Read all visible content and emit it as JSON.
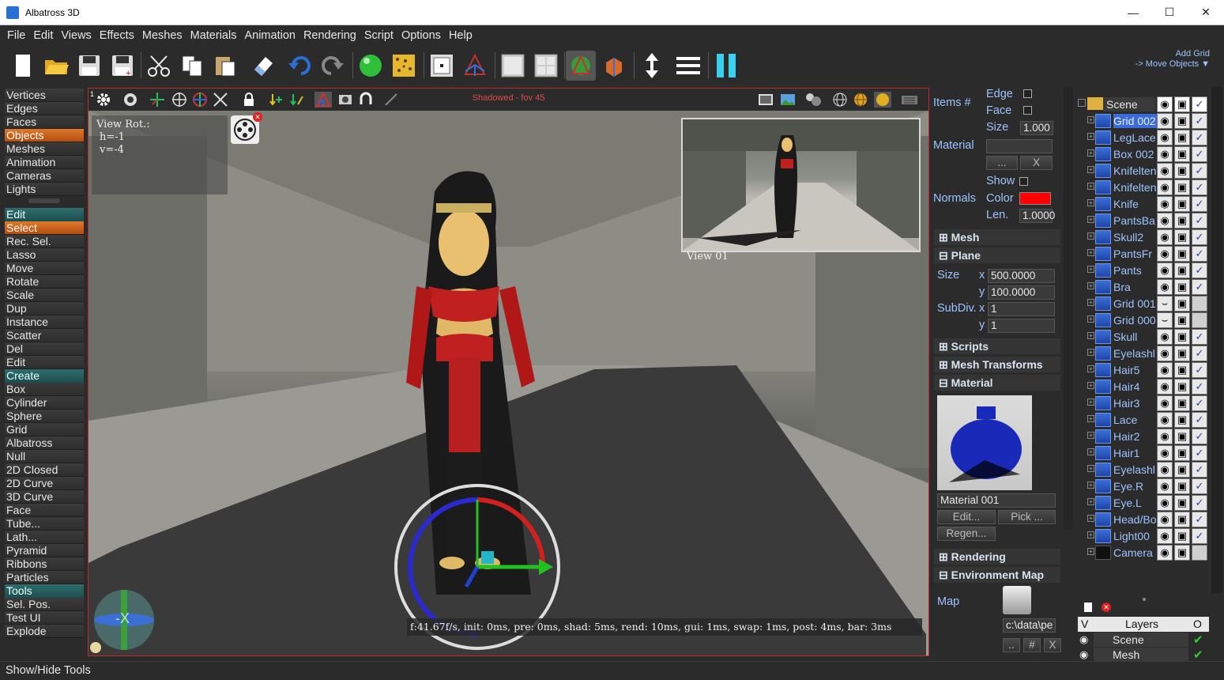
{
  "window": {
    "title": "Albatross 3D"
  },
  "menu": [
    "File",
    "Edit",
    "Views",
    "Effects",
    "Meshes",
    "Materials",
    "Animation",
    "Rendering",
    "Script",
    "Options",
    "Help"
  ],
  "toolbar_hint": {
    "line1": "Add Grid",
    "line2": "-> Move Objects"
  },
  "left_panel": {
    "modes": [
      {
        "label": "Vertices",
        "active": false
      },
      {
        "label": "Edges",
        "active": false
      },
      {
        "label": "Faces",
        "active": false
      },
      {
        "label": "Objects",
        "active": true
      },
      {
        "label": "Meshes",
        "active": false
      },
      {
        "label": "Animation",
        "active": false
      },
      {
        "label": "Cameras",
        "active": false
      },
      {
        "label": "Lights",
        "active": false
      }
    ],
    "edit_header": "Edit",
    "edit_items": [
      {
        "label": "Select",
        "active": true
      },
      {
        "label": "Rec. Sel.",
        "active": false
      },
      {
        "label": "Lasso",
        "active": false
      },
      {
        "label": "Move",
        "active": false
      },
      {
        "label": "Rotate",
        "active": false
      },
      {
        "label": "Scale",
        "active": false
      },
      {
        "label": "Dup",
        "active": false
      },
      {
        "label": "Instance",
        "active": false
      },
      {
        "label": "Scatter",
        "active": false
      },
      {
        "label": "Del",
        "active": false
      },
      {
        "label": "Edit",
        "active": false
      }
    ],
    "create_header": "Create",
    "create_items": [
      "Box",
      "Cylinder",
      "Sphere",
      "Grid",
      "Albatross",
      "Null",
      "2D Closed",
      "2D Curve",
      "3D Curve",
      "Face",
      "Tube...",
      "Lath...",
      "Pyramid",
      "Ribbons",
      "Particles"
    ],
    "tools_header": "Tools",
    "tools_items": [
      "Sel. Pos.",
      "Test UI",
      "Explode"
    ]
  },
  "viewport": {
    "title": "Shadowed - fov 45",
    "view_rot": {
      "label": "View Rot.:",
      "h": "h=-1",
      "v": "v=-4"
    },
    "preview_label": "View 01",
    "stats": "f:41.67f/s, init: 0ms, pre: 0ms, shad: 5ms, rend: 10ms, gui: 1ms, swap: 1ms, post: 4ms, bar: 3ms",
    "gizmo_axis_label": "-X",
    "corner_number": "1"
  },
  "props": {
    "items_label": "Items #",
    "edge_label": "Edge",
    "face_label": "Face",
    "size_label": "Size",
    "size_value": "1.000",
    "material_label": "Material",
    "material_value": "",
    "dots_btn": "...",
    "x_btn": "X",
    "show_label": "Show",
    "normals_label": "Normals",
    "color_label": "Color",
    "normals_color": "#ff0000",
    "len_label": "Len.",
    "len_value": "1.0000",
    "mesh_section": "Mesh",
    "plane_section": "Plane",
    "plane_size_label": "Size",
    "x_label": "x",
    "y_label": "y",
    "plane_size_x": "500.0000",
    "plane_size_y": "100.0000",
    "subdiv_label": "SubDiv.",
    "subdiv_x": "1",
    "subdiv_y": "1",
    "scripts_section": "Scripts",
    "mesh_transforms_section": "Mesh Transforms",
    "material_section": "Material",
    "material_name": "Material 001",
    "edit_btn": "Edit...",
    "pick_btn": "Pick ...",
    "regen_btn": "Regen...",
    "rendering_section": "Rendering",
    "env_map_section": "Environment Map",
    "map_label": "Map",
    "map_path": "c:\\data\\pe",
    "bottom_btns": [
      "..",
      "#",
      "X"
    ]
  },
  "scene_tree": {
    "root": "Scene",
    "items": [
      {
        "name": "Grid 002",
        "selected": true,
        "visible": true,
        "checked": true,
        "type": "mesh"
      },
      {
        "name": "LegLace",
        "selected": false,
        "visible": true,
        "checked": true,
        "type": "mesh"
      },
      {
        "name": "Box 002",
        "selected": false,
        "visible": true,
        "checked": true,
        "type": "mesh"
      },
      {
        "name": "Knifelten",
        "selected": false,
        "visible": true,
        "checked": true,
        "type": "mesh"
      },
      {
        "name": "Knifelten",
        "selected": false,
        "visible": true,
        "checked": true,
        "type": "mesh"
      },
      {
        "name": "Knife",
        "selected": false,
        "visible": true,
        "checked": true,
        "type": "mesh"
      },
      {
        "name": "PantsBa",
        "selected": false,
        "visible": true,
        "checked": true,
        "type": "mesh"
      },
      {
        "name": "Skull2",
        "selected": false,
        "visible": true,
        "checked": true,
        "type": "mesh"
      },
      {
        "name": "PantsFr",
        "selected": false,
        "visible": true,
        "checked": true,
        "type": "mesh"
      },
      {
        "name": "Pants",
        "selected": false,
        "visible": true,
        "checked": true,
        "type": "mesh"
      },
      {
        "name": "Bra",
        "selected": false,
        "visible": true,
        "checked": true,
        "type": "mesh"
      },
      {
        "name": "Grid 001",
        "selected": false,
        "visible": false,
        "checked": false,
        "type": "mesh"
      },
      {
        "name": "Grid 000",
        "selected": false,
        "visible": false,
        "checked": false,
        "type": "mesh"
      },
      {
        "name": "Skull",
        "selected": false,
        "visible": true,
        "checked": true,
        "type": "mesh"
      },
      {
        "name": "Eyelashl",
        "selected": false,
        "visible": true,
        "checked": true,
        "type": "mesh"
      },
      {
        "name": "Hair5",
        "selected": false,
        "visible": true,
        "checked": true,
        "type": "mesh"
      },
      {
        "name": "Hair4",
        "selected": false,
        "visible": true,
        "checked": true,
        "type": "mesh"
      },
      {
        "name": "Hair3",
        "selected": false,
        "visible": true,
        "checked": true,
        "type": "mesh"
      },
      {
        "name": "Lace",
        "selected": false,
        "visible": true,
        "checked": true,
        "type": "mesh"
      },
      {
        "name": "Hair2",
        "selected": false,
        "visible": true,
        "checked": true,
        "type": "mesh"
      },
      {
        "name": "Hair1",
        "selected": false,
        "visible": true,
        "checked": true,
        "type": "mesh"
      },
      {
        "name": "Eyelashl",
        "selected": false,
        "visible": true,
        "checked": true,
        "type": "mesh"
      },
      {
        "name": "Eye.R",
        "selected": false,
        "visible": true,
        "checked": true,
        "type": "mesh"
      },
      {
        "name": "Eye.L",
        "selected": false,
        "visible": true,
        "checked": true,
        "type": "mesh"
      },
      {
        "name": "Head/Bo",
        "selected": false,
        "visible": true,
        "checked": true,
        "type": "mesh"
      },
      {
        "name": "Light00",
        "selected": false,
        "visible": true,
        "checked": true,
        "type": "light"
      },
      {
        "name": "Camera",
        "selected": false,
        "visible": true,
        "checked": false,
        "type": "camera"
      }
    ]
  },
  "layers": {
    "header_v": "V",
    "header_title": "Layers",
    "header_o": "O",
    "rows": [
      {
        "name": "Scene"
      },
      {
        "name": "Mesh"
      }
    ]
  },
  "statusbar": {
    "text": "Show/Hide Tools"
  },
  "colors": {
    "accent_orange": "#c85f1c",
    "teal_header": "#256060",
    "viewport_border": "#c02828",
    "link_blue": "#9ec3ff"
  }
}
